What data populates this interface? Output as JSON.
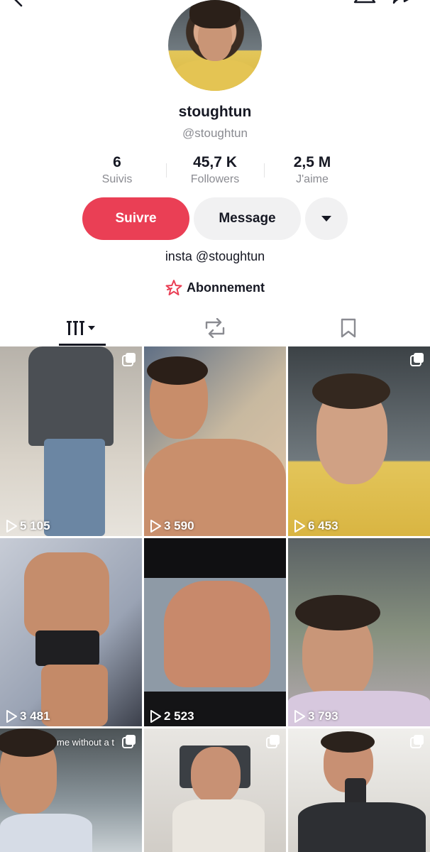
{
  "profile": {
    "username": "stoughtun",
    "handle": "@stoughtun",
    "bio": "insta @stoughtun",
    "subscription_label": "Abonnement"
  },
  "stats": [
    {
      "value": "6",
      "label": "Suivis"
    },
    {
      "value": "45,7 K",
      "label": "Followers"
    },
    {
      "value": "2,5 M",
      "label": "J'aime"
    }
  ],
  "actions": {
    "follow_label": "Suivre",
    "message_label": "Message",
    "more_icon": "caret-down-icon"
  },
  "tabs": [
    {
      "name": "videos",
      "icon": "grid-videos-icon",
      "active": true
    },
    {
      "name": "reposts",
      "icon": "repost-icon",
      "active": false
    },
    {
      "name": "saved",
      "icon": "bookmark-icon",
      "active": false
    }
  ],
  "videos": [
    {
      "views": "5 105",
      "multi": true,
      "caption": ""
    },
    {
      "views": "3 590",
      "multi": false,
      "caption": ""
    },
    {
      "views": "6 453",
      "multi": true,
      "caption": ""
    },
    {
      "views": "3 481",
      "multi": false,
      "caption": ""
    },
    {
      "views": "2 523",
      "multi": false,
      "caption": ""
    },
    {
      "views": "3 793",
      "multi": false,
      "caption": ""
    },
    {
      "views": "",
      "multi": true,
      "caption": "me without a t"
    },
    {
      "views": "",
      "multi": true,
      "caption": ""
    },
    {
      "views": "",
      "multi": true,
      "caption": ""
    }
  ],
  "colors": {
    "accent": "#ea3f55",
    "text": "#161823",
    "muted": "#8a8b91",
    "button_gray": "#f1f1f2"
  }
}
